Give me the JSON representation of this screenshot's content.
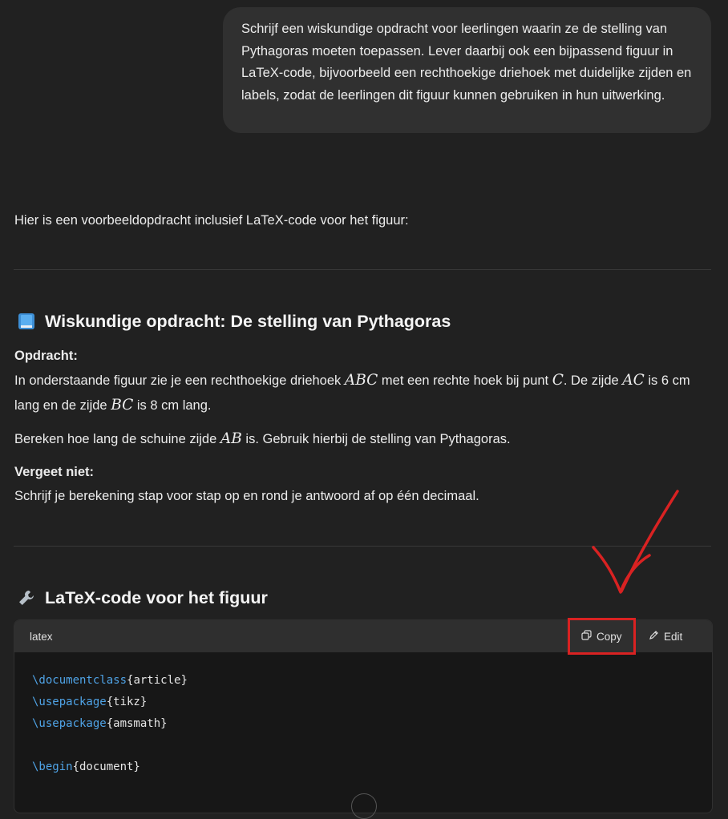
{
  "user_message": "Schrijf een wiskundige opdracht voor leerlingen waarin ze de stelling van Pythagoras moeten toepassen. Lever daarbij ook een bijpassend figuur in LaTeX-code, bijvoorbeeld een rechthoekige driehoek met duidelijke zijden en labels, zodat de leerlingen dit figuur kunnen gebruiken in hun uitwerking.",
  "assistant": {
    "intro": "Hier is een voorbeeldopdracht inclusief LaTeX-code voor het figuur:",
    "section1": {
      "icon": "blue-book-icon",
      "title": "Wiskundige opdracht: De stelling van Pythagoras",
      "opdracht_label": "Opdracht:",
      "p1_a": "In onderstaande figuur zie je een rechthoekige driehoek ",
      "p1_m1": "ABC",
      "p1_b": " met een rechte hoek bij punt ",
      "p1_m2": "C",
      "p1_c": ". De zijde ",
      "p1_m3": "AC",
      "p1_d": " is 6 cm lang en de zijde ",
      "p1_m4": "BC",
      "p1_e": " is 8 cm lang.",
      "p2_a": "Bereken hoe lang de schuine zijde ",
      "p2_m": "AB",
      "p2_b": " is. Gebruik hierbij de stelling van Pythagoras.",
      "vergeet_label": "Vergeet niet:",
      "p3": "Schrijf je berekening stap voor stap op en rond je antwoord af op één decimaal."
    },
    "section2": {
      "icon": "wrench-icon",
      "title": "LaTeX-code voor het figuur",
      "code_language": "latex",
      "copy_label": "Copy",
      "edit_label": "Edit",
      "code_lines": [
        {
          "cmd": "\\documentclass",
          "arg": "{article}"
        },
        {
          "cmd": "\\usepackage",
          "arg": "{tikz}"
        },
        {
          "cmd": "\\usepackage",
          "arg": "{amsmath}"
        },
        {
          "cmd": "",
          "arg": ""
        },
        {
          "cmd": "\\begin",
          "arg": "{document}"
        }
      ]
    }
  },
  "annotation": {
    "color": "#d92222"
  }
}
